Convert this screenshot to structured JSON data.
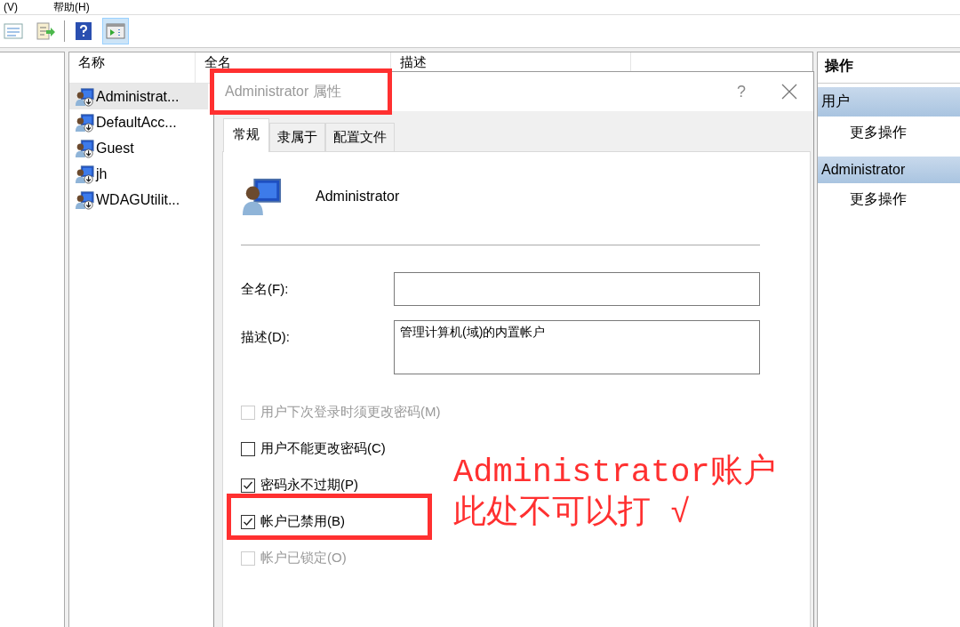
{
  "menu": [
    "(V)",
    "帮助(H)"
  ],
  "toolbar_buttons": [
    {
      "kind": "list",
      "selected": false
    },
    {
      "kind": "export",
      "selected": false
    },
    {
      "kind": "help",
      "selected": false
    },
    {
      "kind": "panel",
      "selected": true
    }
  ],
  "list": {
    "columns": [
      "名称",
      "全名",
      "描述"
    ],
    "rows": [
      {
        "name": "Administrat...",
        "selected": true
      },
      {
        "name": "DefaultAcc...",
        "selected": false
      },
      {
        "name": "Guest",
        "selected": false
      },
      {
        "name": "jh",
        "selected": false
      },
      {
        "name": "WDAGUtilit...",
        "selected": false
      }
    ]
  },
  "actions": {
    "header": "操作",
    "sections": [
      {
        "title": "用户",
        "items": [
          "更多操作"
        ]
      },
      {
        "title": "Administrator",
        "items": [
          "更多操作"
        ]
      }
    ]
  },
  "dialog": {
    "title": "Administrator 属性",
    "help": "?",
    "tabs": [
      {
        "label": "常规",
        "selected": true
      },
      {
        "label": "隶属于",
        "selected": false
      },
      {
        "label": "配置文件",
        "selected": false
      }
    ],
    "user_name": "Administrator",
    "fields": [
      {
        "label": "全名(F):",
        "kind": "line"
      },
      {
        "label": "描述(D):",
        "kind": "area",
        "value": "管理计算机(域)的内置帐户"
      }
    ],
    "checkboxes": [
      {
        "label": "用户下次登录时须更改密码(M)",
        "checked": false,
        "disabled": true
      },
      {
        "label": "用户不能更改密码(C)",
        "checked": false,
        "disabled": false
      },
      {
        "label": "密码永不过期(P)",
        "checked": true,
        "disabled": false
      },
      {
        "label": "帐户已禁用(B)",
        "checked": true,
        "disabled": false
      },
      {
        "label": "帐户已锁定(O)",
        "checked": false,
        "disabled": true
      }
    ]
  },
  "annotation": {
    "lines": [
      "Administrator账户",
      "此处不可以打 √"
    ]
  }
}
